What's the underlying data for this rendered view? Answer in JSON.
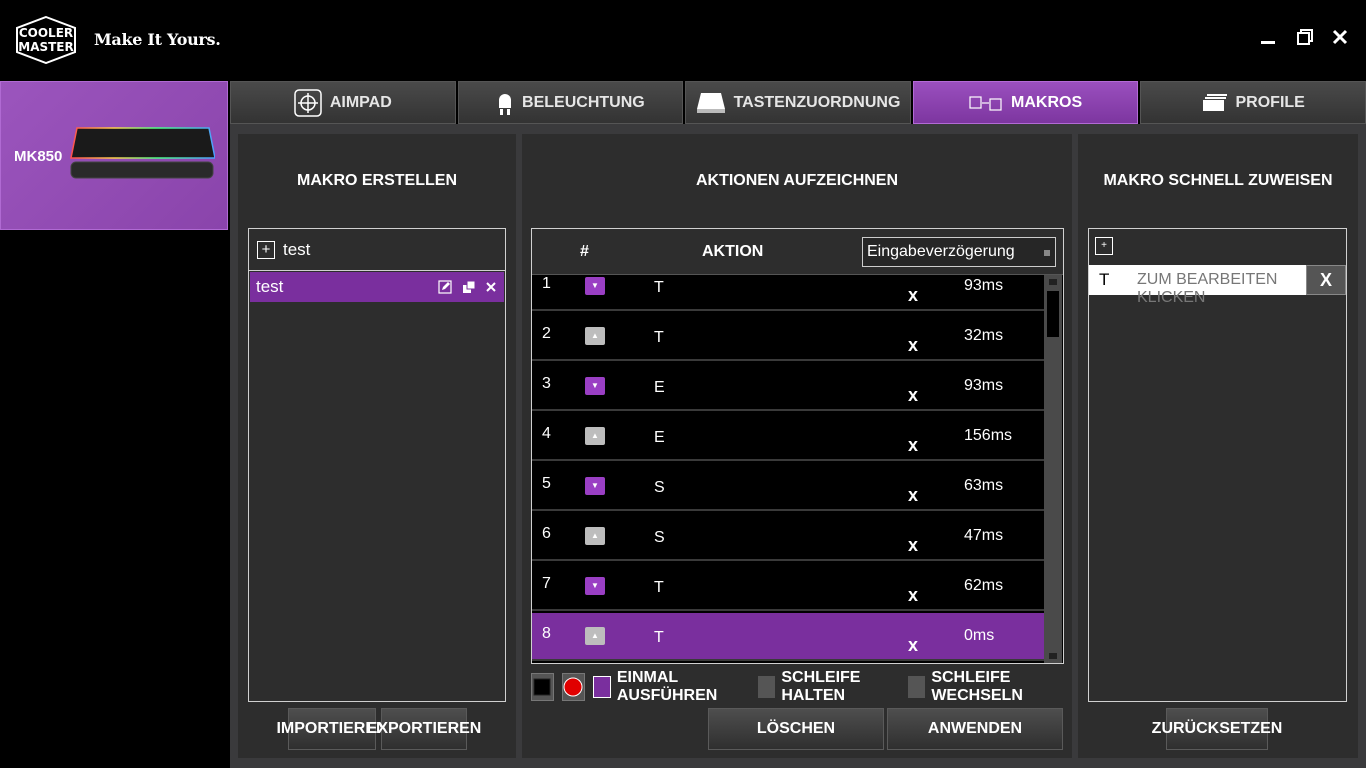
{
  "app": {
    "tagline": "Make It Yours."
  },
  "window": {
    "minimize_icon": "minimize-icon",
    "restore_icon": "restore-icon",
    "close_label": "x"
  },
  "device": {
    "name": "MK850"
  },
  "tabs": [
    {
      "label": "AIMPAD",
      "icon": "crosshair-icon",
      "active": false
    },
    {
      "label": "BELEUCHTUNG",
      "icon": "bulb-icon",
      "active": false
    },
    {
      "label": "TASTENZUORDNUNG",
      "icon": "keycap-icon",
      "active": false
    },
    {
      "label": "MAKROS",
      "icon": "macro-icon",
      "active": true
    },
    {
      "label": "PROFILE",
      "icon": "profiles-icon",
      "active": false
    }
  ],
  "left": {
    "title": "MAKRO ERSTELLEN",
    "group_name": "test",
    "macros": [
      {
        "name": "test"
      }
    ],
    "import_label": "IMPORTIEREN",
    "export_label": "EXPORTIEREN"
  },
  "middle": {
    "title": "AKTIONEN AUFZEICHNEN",
    "col_num": "#",
    "col_action": "AKTION",
    "delay_mode": "Eingabeverzögerung",
    "rows": [
      {
        "num": "1",
        "dir": "down",
        "key": "T",
        "del": "x",
        "ms": "93ms"
      },
      {
        "num": "2",
        "dir": "up",
        "key": "T",
        "del": "x",
        "ms": "32ms"
      },
      {
        "num": "3",
        "dir": "down",
        "key": "E",
        "del": "x",
        "ms": "93ms"
      },
      {
        "num": "4",
        "dir": "up",
        "key": "E",
        "del": "x",
        "ms": "156ms"
      },
      {
        "num": "5",
        "dir": "down",
        "key": "S",
        "del": "x",
        "ms": "63ms"
      },
      {
        "num": "6",
        "dir": "up",
        "key": "S",
        "del": "x",
        "ms": "47ms"
      },
      {
        "num": "7",
        "dir": "down",
        "key": "T",
        "del": "x",
        "ms": "62ms"
      },
      {
        "num": "8",
        "dir": "up",
        "key": "T",
        "del": "x",
        "ms": "0ms",
        "selected": true
      }
    ],
    "mode_once": "EINMAL AUSFÜHREN",
    "mode_hold": "SCHLEIFE HALTEN",
    "mode_toggle": "SCHLEIFE WECHSELN",
    "delete_label": "LÖSCHEN",
    "apply_label": "ANWENDEN"
  },
  "right": {
    "title": "MAKRO SCHNELL ZUWEISEN",
    "assign_key": "T",
    "assign_placeholder": "ZUM BEARBEITEN KLICKEN",
    "remove_label": "X",
    "reset_label": "ZURÜCKSETZEN"
  },
  "colors": {
    "accent": "#7a2f9e",
    "panel": "#2d2d2d",
    "background": "#3a3a3c"
  }
}
